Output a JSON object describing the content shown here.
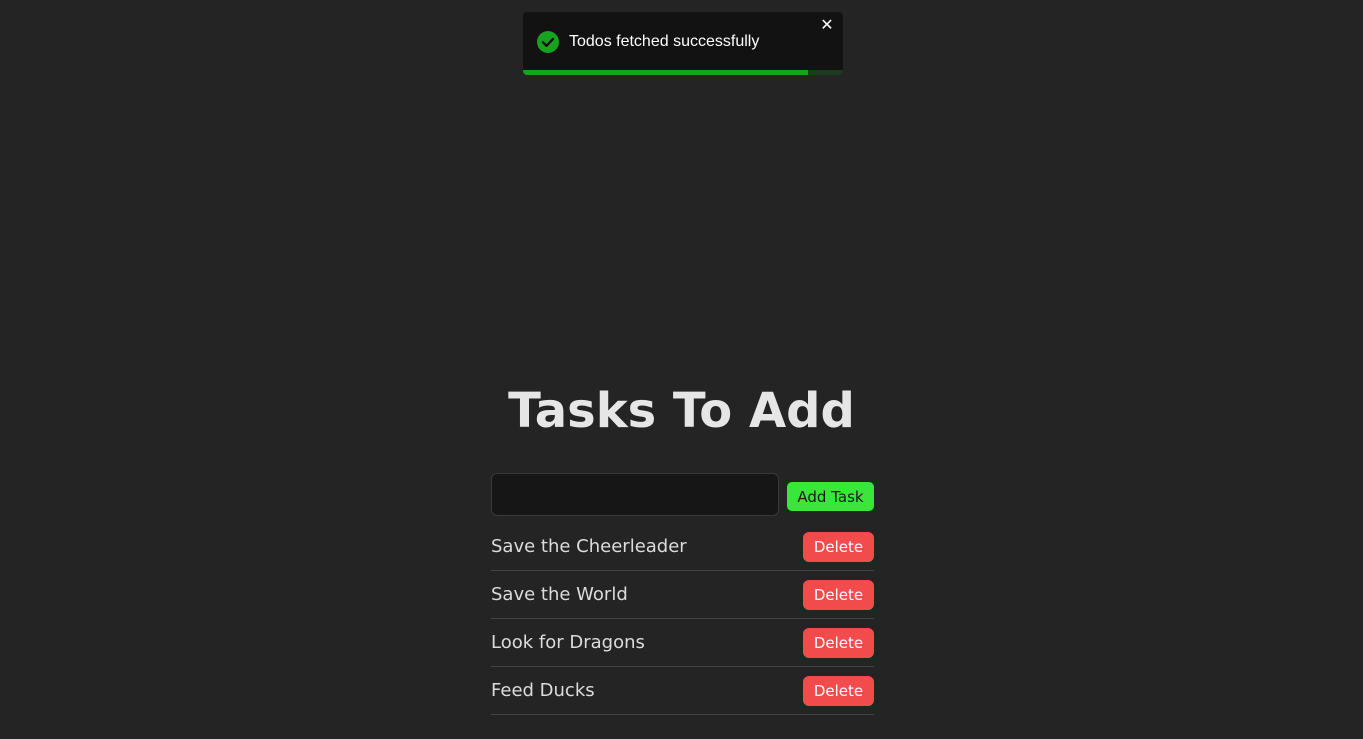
{
  "toast": {
    "message": "Todos fetched successfully",
    "icon": "check-circle-icon",
    "close_symbol": "✕",
    "progress": 0.89,
    "colors": {
      "background": "#121212",
      "success": "#17a21f",
      "progress_track": "#1c3a1e"
    }
  },
  "page": {
    "title": "Tasks To Add"
  },
  "add_form": {
    "input_value": "",
    "input_placeholder": "",
    "add_button_label": "Add Task"
  },
  "tasks": [
    {
      "text": "Save the Cheerleader",
      "delete_label": "Delete"
    },
    {
      "text": "Save the World",
      "delete_label": "Delete"
    },
    {
      "text": "Look for Dragons",
      "delete_label": "Delete"
    },
    {
      "text": "Feed Ducks",
      "delete_label": "Delete"
    }
  ],
  "colors": {
    "background": "#242424",
    "add_button": "#3ae63a",
    "delete_button": "#f24b4b"
  }
}
